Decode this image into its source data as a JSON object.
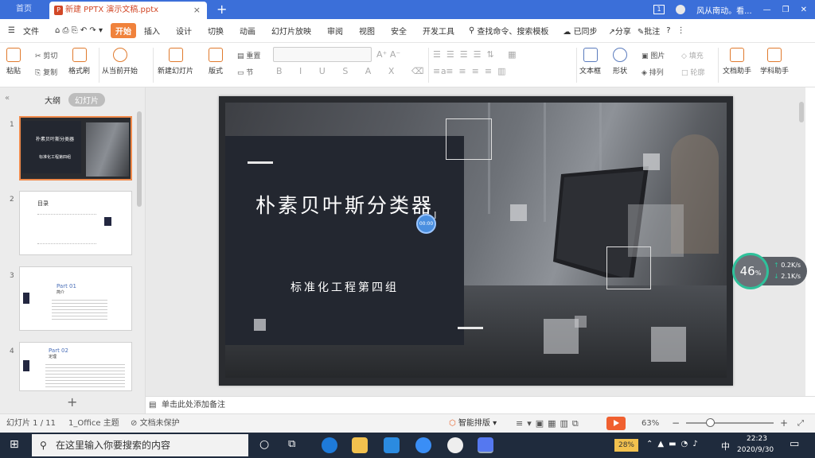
{
  "titlebar": {
    "home_tab": "首页",
    "doc_tab": "新建 PPTX 演示文稿.pptx",
    "doc_icon": "P",
    "user": "风从南动。看..."
  },
  "menu": {
    "file": "文件",
    "start": "开始",
    "items": [
      "插入",
      "设计",
      "切换",
      "动画",
      "幻灯片放映",
      "审阅",
      "视图",
      "安全",
      "开发工具"
    ],
    "search": "查找命令、搜索模板",
    "sync": "已同步",
    "share": "分享",
    "comment": "批注"
  },
  "ribbon": {
    "paste": "粘贴",
    "cut": "剪切",
    "copy": "复制",
    "format_painter": "格式刷",
    "from_current": "从当前开始",
    "new_slide": "新建幻灯片",
    "layout": "版式",
    "reset": "重置",
    "section": "节",
    "textbox": "文本框",
    "shape": "形状",
    "arrange": "排列",
    "picture": "图片",
    "fill": "填充",
    "outline": "轮廓",
    "doc_assistant": "文档助手",
    "study_assistant": "学科助手"
  },
  "left_panel": {
    "tab_outline": "大纲",
    "tab_slides": "幻灯片",
    "thumbs": [
      {
        "num": "1",
        "title": "朴素贝叶斯分类器",
        "sub": "标准化工程第四组"
      },
      {
        "num": "2",
        "title": "目录"
      },
      {
        "num": "3",
        "title": "Part  01",
        "sub": "简介"
      },
      {
        "num": "4",
        "title": "Part  02",
        "sub": "定理"
      }
    ]
  },
  "slide": {
    "title": "朴素贝叶斯分类器",
    "subtitle": "标准化工程第四组",
    "record_badge": "00:00"
  },
  "net_gauge": {
    "percent": "46",
    "unit": "%",
    "up": "0.2K/s",
    "down": "2.1K/s"
  },
  "notes_placeholder": "单击此处添加备注",
  "status": {
    "slide_count": "幻灯片 1 / 11",
    "theme": "1_Office 主题",
    "protection": "文档未保护",
    "smart_layout": "智能排版",
    "zoom": "63%"
  },
  "taskbar": {
    "search_placeholder": "在这里输入你要搜索的内容",
    "battery": "28%",
    "ime": "中",
    "time": "22:23",
    "date": "2020/9/30"
  }
}
